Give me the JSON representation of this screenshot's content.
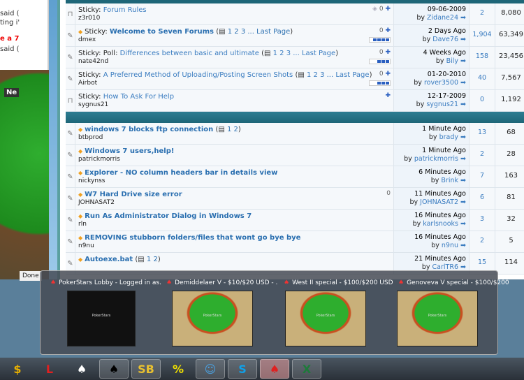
{
  "background": {
    "said1": "said (",
    "ting": "ting i'",
    "red": "e a 7",
    "said2": "said (",
    "new": "Ne"
  },
  "status_bar": {
    "text": "Done"
  },
  "sticky_threads": [
    {
      "prefix": "Sticky:",
      "title": "Forum Rules",
      "bold": false,
      "author": "z3r010",
      "pages": null,
      "last_post": "09-06-2009",
      "last_by": "Zidane24",
      "replies": "2",
      "views": "8,080",
      "icons": "tag clip pin",
      "rating": 0
    },
    {
      "prefix": "Sticky:",
      "title": "Welcome to Seven Forums",
      "bold": true,
      "author": "dmex",
      "pages": "1 2 3 ... Last Page",
      "last_post": "2 Days Ago",
      "last_by": "Dave76",
      "replies": "1,904",
      "views": "63,349",
      "icons": "clip pin",
      "rating": 4
    },
    {
      "prefix": "Sticky: Poll:",
      "title": "Differences between basic and ultimate",
      "bold": false,
      "author": "nate42nd",
      "pages": "1 2 3 ... Last Page",
      "last_post": "4 Weeks Ago",
      "last_by": "Bily",
      "replies": "158",
      "views": "23,456",
      "icons": "clip pin",
      "rating": 3
    },
    {
      "prefix": "Sticky:",
      "title": "A Preferred Method of Uploading/Posting Screen Shots",
      "bold": false,
      "author": "Airbot",
      "pages": "1 2 3 ... Last Page",
      "last_post": "01-20-2010",
      "last_by": "rover3500",
      "replies": "40",
      "views": "7,567",
      "icons": "clip pin",
      "rating": 3
    },
    {
      "prefix": "Sticky:",
      "title": "How To Ask For Help",
      "bold": false,
      "author": "sygnus21",
      "pages": null,
      "last_post": "12-17-2009",
      "last_by": "sygnus21",
      "replies": "0",
      "views": "1,192",
      "icons": "pin",
      "rating": 0
    }
  ],
  "threads": [
    {
      "title": "windows 7 blocks ftp connection",
      "author": "btbprod",
      "pages": "1 2",
      "last_post": "1 Minute Ago",
      "last_by": "brady",
      "replies": "13",
      "views": "68",
      "icons": ""
    },
    {
      "title": "Windows 7 users,help!",
      "author": "patrickmorris",
      "pages": null,
      "last_post": "1 Minute Ago",
      "last_by": "patrickmorris",
      "replies": "2",
      "views": "28",
      "icons": ""
    },
    {
      "title": "Explorer - NO column headers bar in details view",
      "author": "nickynss",
      "pages": null,
      "last_post": "6 Minutes Ago",
      "last_by": "Brink",
      "replies": "7",
      "views": "163",
      "icons": ""
    },
    {
      "title": "W7 Hard Drive size error",
      "author": "JOHNASAT2",
      "pages": null,
      "last_post": "11 Minutes Ago",
      "last_by": "JOHNASAT2",
      "replies": "6",
      "views": "81",
      "icons": "clip"
    },
    {
      "title": "Run As Administrator Dialog in Windows 7",
      "author": "rln",
      "pages": null,
      "last_post": "16 Minutes Ago",
      "last_by": "karlsnooks",
      "replies": "3",
      "views": "32",
      "icons": ""
    },
    {
      "title": "REMOVING stubborn folders/files that wont go bye bye",
      "author": "n9nu",
      "pages": null,
      "last_post": "16 Minutes Ago",
      "last_by": "n9nu",
      "replies": "2",
      "views": "5",
      "icons": ""
    },
    {
      "title": "Autoexe.bat",
      "author": "",
      "pages": "1 2",
      "last_post": "21 Minutes Ago",
      "last_by": "CarlTR6",
      "replies": "15",
      "views": "114",
      "icons": ""
    }
  ],
  "labels": {
    "by": "by"
  },
  "previews": [
    {
      "title": "PokerStars Lobby - Logged in as...",
      "thumb": "lobby",
      "logo": "PokerStars"
    },
    {
      "title": "Demiddelaer V - $10/$20 USD - ...",
      "thumb": "table",
      "logo": "PokerStars"
    },
    {
      "title": "West II special - $100/$200 USD ...",
      "thumb": "table",
      "logo": "PokerStars"
    },
    {
      "title": "Genoveva V special - $100/$200 ...",
      "thumb": "table",
      "logo": "PokerStars"
    }
  ],
  "taskbar": [
    {
      "name": "chip-app",
      "glyph": "$",
      "color": "#e8b000"
    },
    {
      "name": "red-l-app",
      "glyph": "L",
      "color": "#e02020"
    },
    {
      "name": "spade-green-app",
      "glyph": "♠",
      "color": "#ffffff"
    },
    {
      "name": "spade-card-app",
      "glyph": "♠",
      "color": "#000000"
    },
    {
      "name": "sb-app",
      "glyph": "SB",
      "color": "#e8c030"
    },
    {
      "name": "percent-app",
      "glyph": "%",
      "color": "#f0e000"
    },
    {
      "name": "messenger-app",
      "glyph": "☺",
      "color": "#4aa0e0"
    },
    {
      "name": "skype-app",
      "glyph": "S",
      "color": "#10a0e8"
    },
    {
      "name": "pokerstars-app",
      "glyph": "♠",
      "color": "#e02020"
    },
    {
      "name": "excel-app",
      "glyph": "X",
      "color": "#1d7a3a"
    }
  ]
}
